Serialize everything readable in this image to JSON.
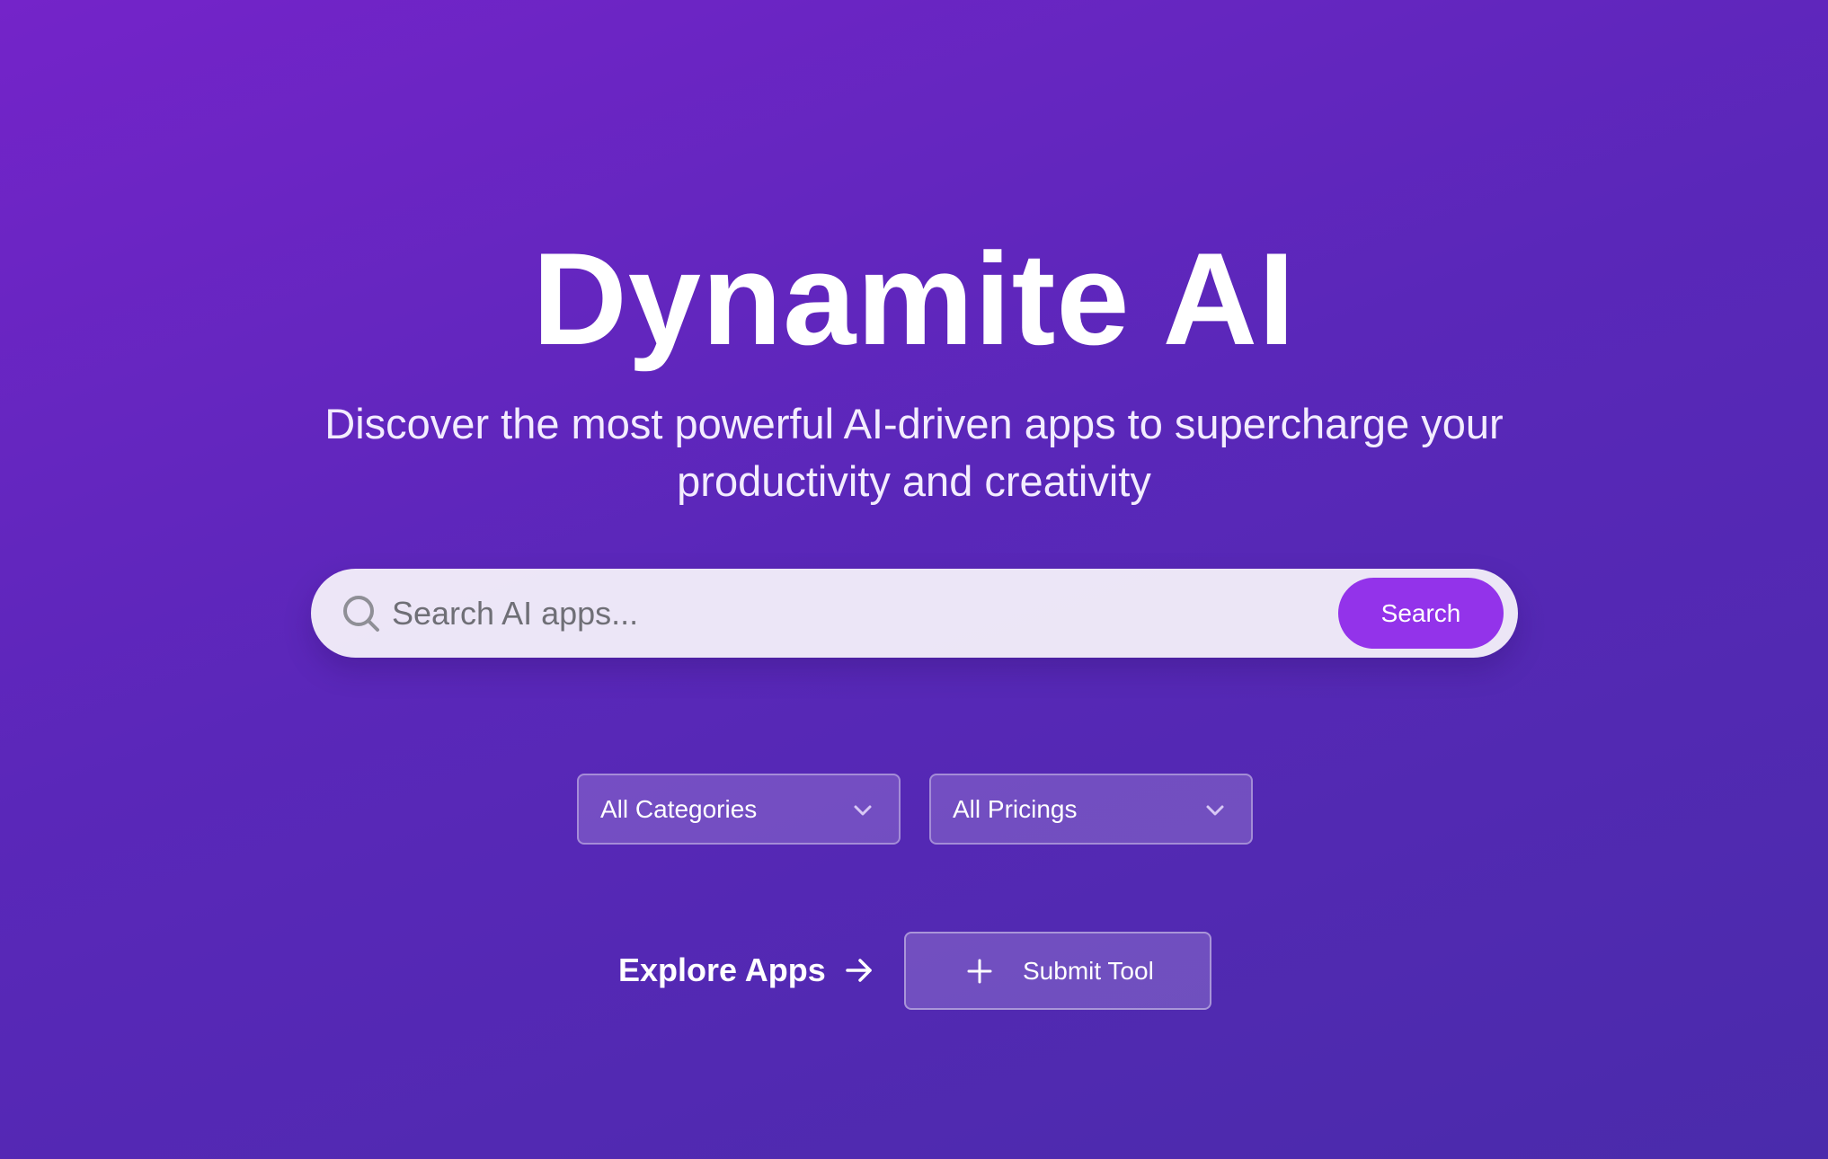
{
  "hero": {
    "title": "Dynamite AI",
    "subtitle_line1": "Discover the most powerful AI-driven apps to supercharge your",
    "subtitle_line2": "productivity and creativity"
  },
  "search": {
    "placeholder": "Search AI apps...",
    "value": "",
    "button_label": "Search",
    "icon": "search-icon"
  },
  "filters": {
    "category": {
      "selected": "All Categories",
      "icon": "chevron-down-icon"
    },
    "pricing": {
      "selected": "All Pricings",
      "icon": "chevron-down-icon"
    }
  },
  "actions": {
    "explore_label": "Explore Apps",
    "explore_icon": "arrow-right-icon",
    "submit_label": "Submit Tool",
    "submit_icon": "plus-icon"
  },
  "colors": {
    "background_start": "#7424c9",
    "background_end": "#4a2bab",
    "accent": "#9333ea",
    "search_bar": "#f4f0fa"
  }
}
